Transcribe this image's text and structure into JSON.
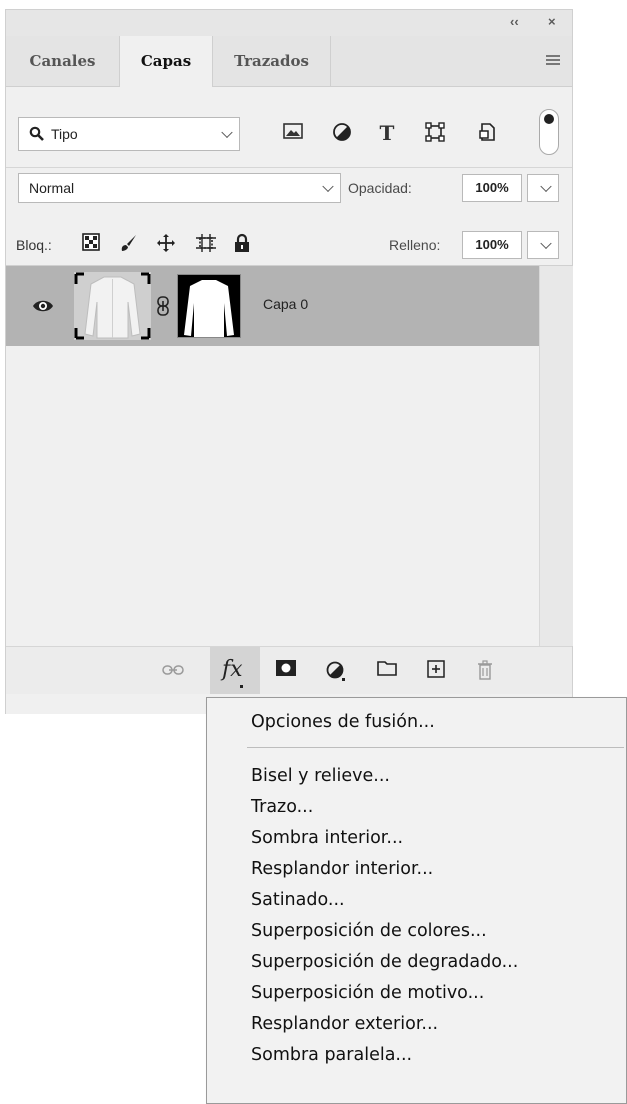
{
  "titlebar": {
    "collapse_icon": "double-chevron-left-icon",
    "close_icon": "close-icon"
  },
  "tabs": [
    {
      "label": "Canales",
      "active": false
    },
    {
      "label": "Capas",
      "active": true
    },
    {
      "label": "Trazados",
      "active": false
    }
  ],
  "filter": {
    "kind_label": "Tipo",
    "icons": [
      "image-filter-icon",
      "adjustment-filter-icon",
      "type-filter-icon",
      "shape-filter-icon",
      "smart-object-filter-icon"
    ]
  },
  "blend": {
    "mode": "Normal",
    "opacity_label": "Opacidad:",
    "opacity_value": "100%"
  },
  "lock": {
    "label": "Bloq.:",
    "fill_label": "Relleno:",
    "fill_value": "100%"
  },
  "layers": [
    {
      "name": "Capa 0",
      "visible": true,
      "selected": true
    }
  ],
  "context_menu": {
    "items": [
      "Opciones de fusión...",
      "Bisel y relieve...",
      "Trazo...",
      "Sombra interior...",
      "Resplandor interior...",
      "Satinado...",
      "Superposición de colores...",
      "Superposición de degradado...",
      "Superposición de motivo...",
      "Resplandor exterior...",
      "Sombra paralela..."
    ]
  },
  "colors": {
    "panel_bg": "#f0f0f0",
    "selected_layer": "#b3b3b3",
    "menu_bg": "#f2f2f2"
  }
}
